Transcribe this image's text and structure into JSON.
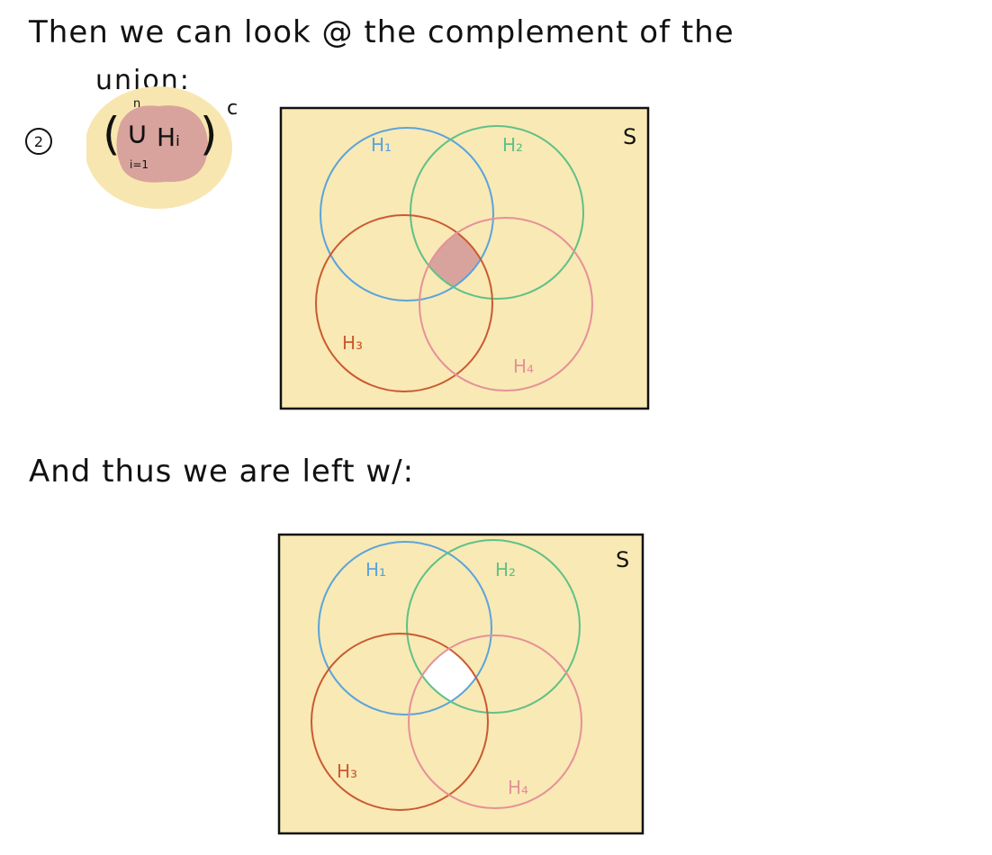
{
  "text": {
    "line1": "Then we can look @ the complement of the",
    "line1b": "union:",
    "line2": "And thus we are left w/:"
  },
  "step": {
    "number": "2"
  },
  "formula": {
    "paren_open": "(",
    "union_symbol": "∪",
    "upper": "n",
    "lower": "i=1",
    "set": "Hᵢ",
    "paren_close": ")",
    "superscript": "c"
  },
  "diagrams": [
    {
      "sample_space": "S",
      "labels": {
        "h1": "H₁",
        "h2": "H₂",
        "h3": "H₃",
        "h4": "H₄"
      },
      "center_region": "shaded"
    },
    {
      "sample_space": "S",
      "labels": {
        "h1": "H₁",
        "h2": "H₂",
        "h3": "H₃",
        "h4": "H₄"
      },
      "center_region": "white"
    }
  ],
  "colors": {
    "background_fill": "#f9e9b4",
    "highlight": "#d9a39d",
    "formula_glow": "#f8e6b0",
    "h1": "#5aa4dc",
    "h2": "#5fc188",
    "h3": "#c95a32",
    "h4": "#e4919a",
    "outline": "#111111"
  }
}
